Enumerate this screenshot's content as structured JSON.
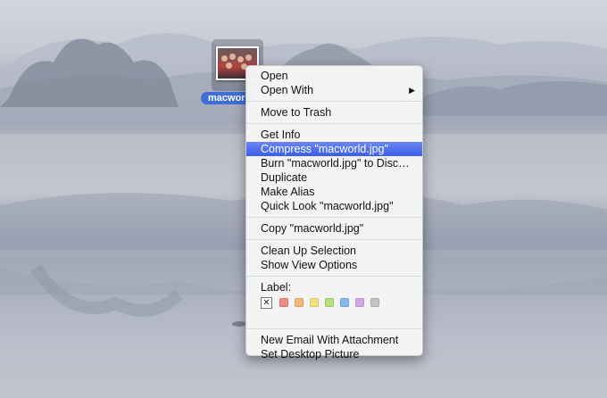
{
  "desktop": {
    "file": {
      "name": "macworld.jpg",
      "label": "macworl"
    }
  },
  "context_menu": {
    "groups": [
      [
        {
          "label": "Open"
        },
        {
          "label": "Open With",
          "submenu": true
        }
      ],
      [
        {
          "label": "Move to Trash"
        }
      ],
      [
        {
          "label": "Get Info"
        },
        {
          "label": "Compress \"macworld.jpg\"",
          "highlighted": true
        },
        {
          "label": "Burn \"macworld.jpg\" to Disc…"
        },
        {
          "label": "Duplicate"
        },
        {
          "label": "Make Alias"
        },
        {
          "label": "Quick Look \"macworld.jpg\""
        }
      ],
      [
        {
          "label": "Copy \"macworld.jpg\""
        }
      ],
      [
        {
          "label": "Clean Up Selection"
        },
        {
          "label": "Show View Options"
        }
      ]
    ],
    "label_section": {
      "title": "Label:",
      "none_symbol": "✕",
      "colors": [
        {
          "name": "red",
          "hex": "#f08a85"
        },
        {
          "name": "orange",
          "hex": "#f4b87a"
        },
        {
          "name": "yellow",
          "hex": "#f0e27e"
        },
        {
          "name": "green",
          "hex": "#b9e07e"
        },
        {
          "name": "blue",
          "hex": "#86b8f2"
        },
        {
          "name": "purple",
          "hex": "#d4a6e6"
        },
        {
          "name": "gray",
          "hex": "#c4c4c4"
        }
      ]
    },
    "bottom_group": [
      {
        "label": "New Email With Attachment"
      },
      {
        "label": "Set Desktop Picture"
      }
    ],
    "submenu_arrow": "▶"
  },
  "colors": {
    "highlight": "#3b5ee6",
    "selection_label": "#3f6ed6"
  }
}
